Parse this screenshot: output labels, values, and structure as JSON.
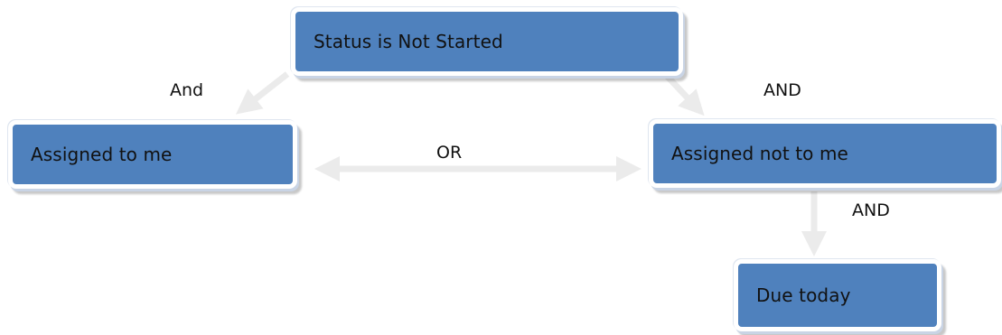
{
  "nodes": {
    "status": "Status is Not Started",
    "assigned_me": "Assigned to me",
    "assigned_not_me": "Assigned not to me",
    "due_today": "Due today"
  },
  "edges": {
    "status_to_me": "And",
    "status_to_not_me": "AND",
    "me_or_not_me": "OR",
    "not_me_to_due": "AND"
  },
  "colors": {
    "node_fill": "#4f81bd",
    "arrow": "#ebebeb"
  }
}
